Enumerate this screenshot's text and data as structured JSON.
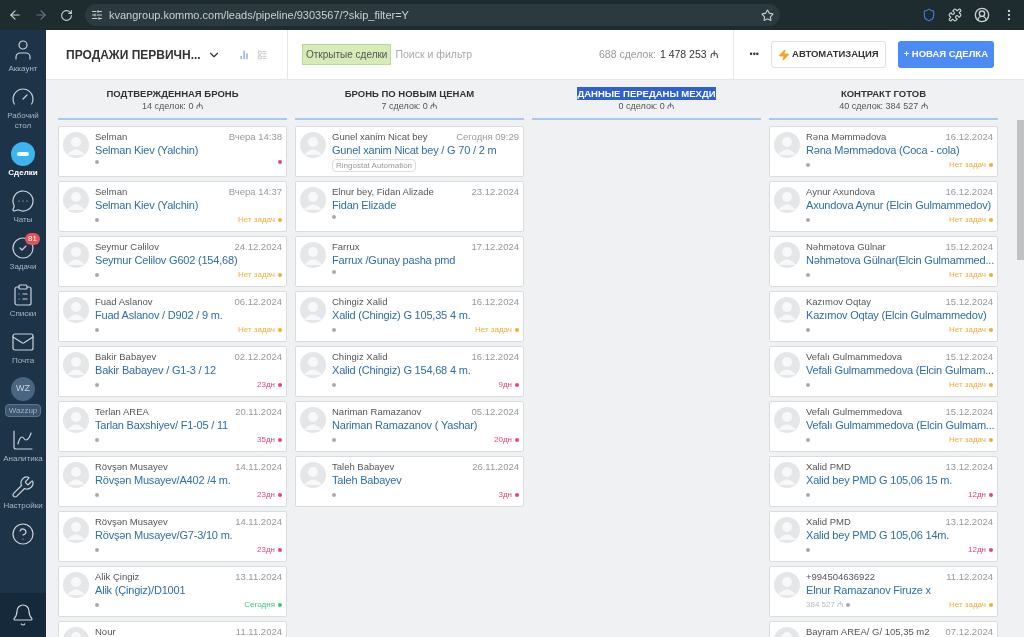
{
  "browser": {
    "url": "kvangroup.kommo.com/leads/pipeline/9303567/?skip_filter=Y"
  },
  "sidebar": {
    "items": [
      {
        "label": "Аккаунт",
        "kind": "account",
        "selected": false
      },
      {
        "label": "Рабочий стол",
        "kind": "dashboard",
        "selected": false
      },
      {
        "label": "Сделки",
        "kind": "leads",
        "selected": true
      },
      {
        "label": "Чаты",
        "kind": "chats",
        "selected": false
      },
      {
        "label": "Задачи",
        "kind": "tasks",
        "selected": false,
        "badge": "81"
      },
      {
        "label": "Списки",
        "kind": "lists",
        "selected": false
      },
      {
        "label": "Почта",
        "kind": "mail",
        "selected": false
      },
      {
        "label": "Wazzup",
        "kind": "wazzup",
        "selected": false,
        "initials": "WZ"
      },
      {
        "label": "Аналитика",
        "kind": "analytics",
        "selected": false
      },
      {
        "label": "Настройки",
        "kind": "settings",
        "selected": false
      },
      {
        "kind": "help",
        "selected": false
      },
      {
        "kind": "notifications",
        "selected": false
      }
    ]
  },
  "header": {
    "pipeline": "ПРОДАЖИ ПЕРВИЧН...",
    "filter_tag": "Открытые сделки",
    "search_placeholder": "Поиск и фильтр",
    "total_label": "688 сделок:",
    "total_value": "1 478 253 ₼",
    "more": "•••",
    "automation_button": "АВТОМАТИЗАЦИЯ",
    "new_button": "+ НОВАЯ СДЕЛКА"
  },
  "columns": [
    {
      "title": "ПОДТВЕРЖДЕННАЯ БРОНЬ",
      "summary": "14 сделок: 0 ₼",
      "selected": false,
      "cards": [
        {
          "contact": "Selman",
          "date": "Вчера 14:38",
          "title": "Selman Kiev (Yalchin)",
          "color": "#e8457a"
        },
        {
          "contact": "Selman",
          "date": "Вчера 14:37",
          "title": "Selman Kiev (Yalchin)",
          "status": "Нет задач",
          "color": "#f0ad3a"
        },
        {
          "contact": "Seymur Cəlilov",
          "date": "24.12.2024",
          "title": "Seymur Celilov G602 (154,68)",
          "status": "Нет задач",
          "color": "#f0ad3a"
        },
        {
          "contact": "Fuad Aslanov",
          "date": "06.12.2024",
          "title": "Fuad Aslanov / D902 / 9 m.",
          "status": "Нет задач",
          "color": "#f0ad3a"
        },
        {
          "contact": "Bakir Babayev",
          "date": "02.12.2024",
          "title": "Bakir Babayev / G1-3 / 12",
          "status": "23дн",
          "color": "#e8457a"
        },
        {
          "contact": "Terlan AREA",
          "date": "20.11.2024",
          "title": "Tarlan Baxshiyev/ F1-05 / 11",
          "status": "35дн",
          "color": "#e8457a"
        },
        {
          "contact": "Rövşən Musayev",
          "date": "14.11.2024",
          "title": "Rövşən Musayev/A402 /4 m.",
          "status": "23дн",
          "color": "#e8457a"
        },
        {
          "contact": "Rövşən Musayev",
          "date": "14.11.2024",
          "title": "Rövşən Musayev/G7-3/10 m.",
          "status": "23дн",
          "color": "#e8457a"
        },
        {
          "contact": "Alik Çingiz",
          "date": "13.11.2024",
          "title": "Alik (Çingiz)/D1001",
          "status": "Сегодня",
          "color": "#3cc47c"
        },
        {
          "contact": "Nour",
          "date": "11.11.2024"
        }
      ]
    },
    {
      "title": "БРОНЬ ПО НОВЫМ ЦЕНАМ",
      "summary": "7 сделок: 0 ₼",
      "selected": false,
      "cards": [
        {
          "contact": "Gunel xanim Nicat bey",
          "date": "Сегодня 09:29",
          "title": "Gunel xanim Nicat bey / G 70 / 2 m",
          "tag": "Ringostat Automation"
        },
        {
          "contact": "Elnur bey, Fidan Alizade",
          "date": "23.12.2024",
          "title": "Fidan Elizade"
        },
        {
          "contact": "Farrux",
          "date": "17.12.2024",
          "title": "Farrux /Gunay pasha pmd"
        },
        {
          "contact": "Chingiz Xalid",
          "date": "16.12.2024",
          "title": "Xalid (Chingiz) G 105,35 4 m.",
          "status": "Нет задач",
          "color": "#f0ad3a"
        },
        {
          "contact": "Chingiz Xalid",
          "date": "16.12.2024",
          "title": "Xalid (Chingiz) G 154,68 4 m.",
          "status": "9дн",
          "color": "#e8457a"
        },
        {
          "contact": "Nariman Ramazanov",
          "date": "05.12.2024",
          "title": "Nariman Ramazanov ( Yashar)",
          "status": "20дн",
          "color": "#e8457a"
        },
        {
          "contact": "Taleh Babayev",
          "date": "26.11.2024",
          "title": "Taleh Babayev",
          "status": "3дн",
          "color": "#e8457a"
        }
      ]
    },
    {
      "title": "ДАННЫЕ ПЕРЕДАНЫ МЕХДИ",
      "summary": "0 сделок: 0 ₼",
      "selected": true
    },
    {
      "title": "КОНТРАКТ ГОТОВ",
      "summary": "40 сделок: 384 527 ₼",
      "selected": false,
      "cards": [
        {
          "contact": "Rəna Məmmədova",
          "date": "16.12.2024",
          "title": "Rəna Məmmədova (Coca - cola)",
          "status": "Нет задач",
          "color": "#f0ad3a"
        },
        {
          "contact": "Aynur Axundova",
          "date": "16.12.2024",
          "title": "Axundova Aynur (Elcin Gulmammedov)",
          "status": "Нет задач",
          "color": "#f0ad3a"
        },
        {
          "contact": "Nəhmətova Gülnar",
          "date": "15.12.2024",
          "title": "Nəhmətova Gülnar(Elcin Gulmammed...",
          "status": "Нет задач",
          "color": "#f0ad3a"
        },
        {
          "contact": "Kazımov Oqtay",
          "date": "15.12.2024",
          "title": "Kazımov Oqtay (Elcin Gulmammedov)",
          "status": "Нет задач",
          "color": "#f0ad3a"
        },
        {
          "contact": "Vefalı Gulmammedova",
          "date": "15.12.2024",
          "title": "Vefali Gulmammedova (Elcin Gulmam...",
          "status": "Нет задач",
          "color": "#f0ad3a"
        },
        {
          "contact": "Vefalı Gulmemmedova",
          "date": "15.12.2024",
          "title": "Vefalı Gulmammedova (Elcin Gulmam...",
          "status": "Нет задач",
          "color": "#f0ad3a"
        },
        {
          "contact": "Xalid PMD",
          "date": "13.12.2024",
          "title": "Xalid bey PMD G 105,06 15 m.",
          "status": "12дн",
          "color": "#e8457a"
        },
        {
          "contact": "Xalid PMD",
          "date": "13.12.2024",
          "title": "Xalid bey PMD G 105,06 14m.",
          "status": "12дн",
          "color": "#e8457a"
        },
        {
          "contact": "+994504636922",
          "date": "11.12.2024",
          "title": "Elnur Ramazanov Firuze x",
          "price": "384 527 ₼",
          "status": "Нет задач",
          "color": "#f0ad3a"
        },
        {
          "contact": "Bayram AREA/ G/ 105,35 m2",
          "date": "07.12.2024"
        }
      ]
    }
  ]
}
